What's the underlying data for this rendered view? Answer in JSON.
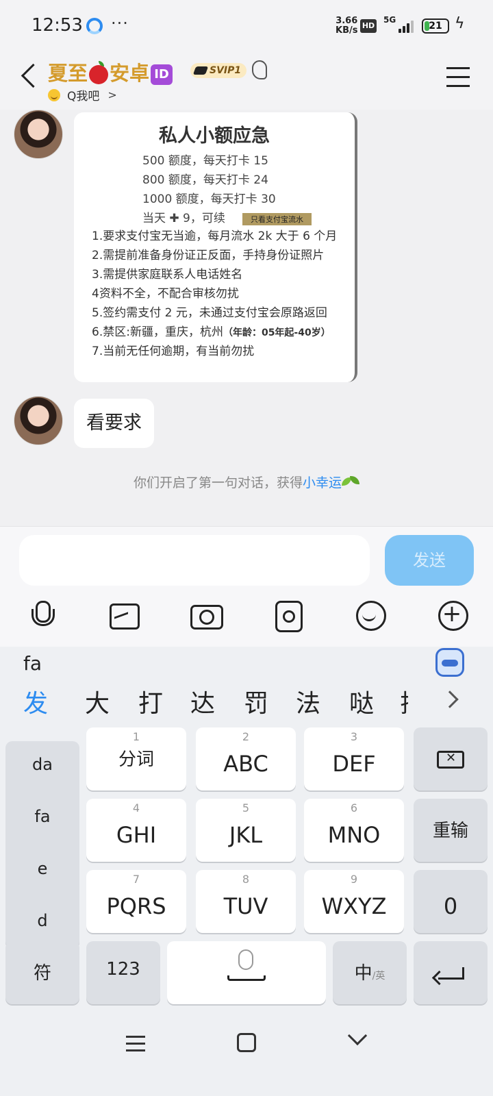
{
  "status_bar": {
    "time": "12:53",
    "more": "···",
    "net_speed_value": "3.66",
    "net_speed_unit": "KB/s",
    "hd": "HD",
    "network": "5G",
    "battery": "21",
    "battery_level": 21,
    "icons": [
      "qq-icon",
      "signal-icon",
      "battery-icon",
      "charging-icon"
    ]
  },
  "header": {
    "title_part1": "夏至",
    "title_part2": "安卓",
    "id_badge": "ID",
    "svip": "SVIP1",
    "sub_status": "Q我吧",
    "title_color": "#d49b2c"
  },
  "chat": {
    "card": {
      "title": "私人小额应急",
      "quota": [
        "500 额度，每天打卡 15",
        "800 额度，每天打卡 24",
        "1000 额度，每天打卡 30",
        "当天 ✚ 9，可续"
      ],
      "tag": "只看支付宝流水",
      "rules": [
        "1.要求支付宝无当逾，每月流水 2k 大于 6 个月",
        "2.需提前准备身份证正反面，手持身份证照片",
        "3.需提供家庭联系人电话姓名",
        "4资料不全，不配合审核勿扰",
        "5.签约需支付 2 元，未通过支付宝会原路返回",
        "6.禁区:新疆，重庆，杭州",
        "7.当前无任何逾期，有当前勿扰"
      ],
      "rule6_note": "（年龄：05年起-40岁）"
    },
    "text_message": "看要求",
    "system_note_prefix": "你们开启了第一句对话，获得",
    "system_note_link": "小幸运"
  },
  "input": {
    "value": "",
    "send_label": "发送",
    "send_color": "#7fc4f5",
    "tools": [
      "mic-icon",
      "image-icon",
      "camera-icon",
      "pocket-icon",
      "emoji-icon",
      "plus-icon"
    ]
  },
  "keyboard": {
    "composing": "fa",
    "candidates": [
      "发",
      "大",
      "打",
      "达",
      "罚",
      "法",
      "哒",
      "拉"
    ],
    "pinyin": [
      "da",
      "fa",
      "e",
      "d"
    ],
    "keys": [
      {
        "num": "1",
        "label": "分词"
      },
      {
        "num": "2",
        "label": "ABC"
      },
      {
        "num": "3",
        "label": "DEF"
      },
      {
        "num": "4",
        "label": "GHI"
      },
      {
        "num": "5",
        "label": "JKL"
      },
      {
        "num": "6",
        "label": "MNO"
      },
      {
        "num": "7",
        "label": "PQRS"
      },
      {
        "num": "8",
        "label": "TUV"
      },
      {
        "num": "9",
        "label": "WXYZ"
      }
    ],
    "reinput": "重输",
    "zero": "0",
    "symbol": "符",
    "numeric": "123",
    "lang_main": "中",
    "lang_sub": "/英"
  }
}
